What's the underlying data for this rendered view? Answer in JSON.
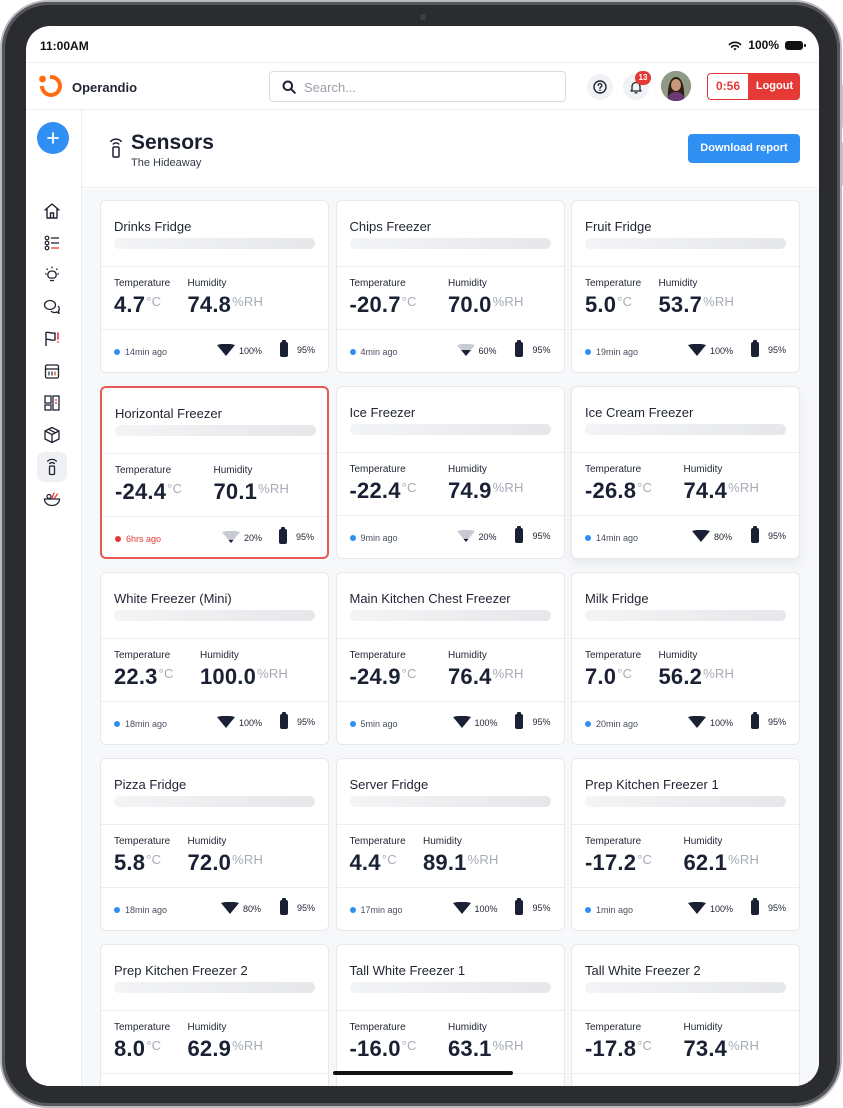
{
  "status_bar": {
    "time": "11:00AM",
    "battery": "100%"
  },
  "header": {
    "brand": "Operandio",
    "search_placeholder": "Search...",
    "notifications_count": "13",
    "timer": "0:56",
    "logout_label": "Logout"
  },
  "page": {
    "title": "Sensors",
    "subtitle": "The Hideaway",
    "download_label": "Download report"
  },
  "labels": {
    "temperature": "Temperature",
    "humidity": "Humidity",
    "temp_unit": "°C",
    "humidity_unit": "%RH"
  },
  "sidebar_icons": [
    "plus-icon",
    "home-icon",
    "checklist-icon",
    "lightbulb-icon",
    "chat-icon",
    "flag-icon",
    "calendar-icon",
    "dashboard-icon",
    "box-icon",
    "sensor-icon",
    "food-icon"
  ],
  "sensors": [
    {
      "name": "Drinks Fridge",
      "temperature": "4.7",
      "humidity": "74.8",
      "last_seen": "14min ago",
      "signal": "100%",
      "battery": "95%",
      "status": "ok"
    },
    {
      "name": "Chips Freezer",
      "temperature": "-20.7",
      "humidity": "70.0",
      "last_seen": "4min ago",
      "signal": "60%",
      "battery": "95%",
      "status": "ok"
    },
    {
      "name": "Fruit Fridge",
      "temperature": "5.0",
      "humidity": "53.7",
      "last_seen": "19min ago",
      "signal": "100%",
      "battery": "95%",
      "status": "ok"
    },
    {
      "name": "Horizontal Freezer",
      "temperature": "-24.4",
      "humidity": "70.1",
      "last_seen": "6hrs ago",
      "signal": "20%",
      "battery": "95%",
      "status": "alert"
    },
    {
      "name": "Ice Freezer",
      "temperature": "-22.4",
      "humidity": "74.9",
      "last_seen": "9min ago",
      "signal": "20%",
      "battery": "95%",
      "status": "ok"
    },
    {
      "name": "Ice Cream Freezer",
      "temperature": "-26.8",
      "humidity": "74.4",
      "last_seen": "14min ago",
      "signal": "80%",
      "battery": "95%",
      "status": "ok"
    },
    {
      "name": "White Freezer (Mini)",
      "temperature": "22.3",
      "humidity": "100.0",
      "last_seen": "18min ago",
      "signal": "100%",
      "battery": "95%",
      "status": "ok"
    },
    {
      "name": "Main Kitchen Chest Freezer",
      "temperature": "-24.9",
      "humidity": "76.4",
      "last_seen": "5min ago",
      "signal": "100%",
      "battery": "95%",
      "status": "ok"
    },
    {
      "name": "Milk Fridge",
      "temperature": "7.0",
      "humidity": "56.2",
      "last_seen": "20min ago",
      "signal": "100%",
      "battery": "95%",
      "status": "ok"
    },
    {
      "name": "Pizza Fridge",
      "temperature": "5.8",
      "humidity": "72.0",
      "last_seen": "18min ago",
      "signal": "80%",
      "battery": "95%",
      "status": "ok"
    },
    {
      "name": "Server Fridge",
      "temperature": "4.4",
      "humidity": "89.1",
      "last_seen": "17min ago",
      "signal": "100%",
      "battery": "95%",
      "status": "ok"
    },
    {
      "name": "Prep Kitchen Freezer 1",
      "temperature": "-17.2",
      "humidity": "62.1",
      "last_seen": "1min ago",
      "signal": "100%",
      "battery": "95%",
      "status": "ok"
    },
    {
      "name": "Prep Kitchen Freezer 2",
      "temperature": "8.0",
      "humidity": "62.9",
      "last_seen": "",
      "signal": "",
      "battery": "",
      "status": "ok"
    },
    {
      "name": "Tall White Freezer 1",
      "temperature": "-16.0",
      "humidity": "63.1",
      "last_seen": "",
      "signal": "",
      "battery": "",
      "status": "ok"
    },
    {
      "name": "Tall White Freezer 2",
      "temperature": "-17.8",
      "humidity": "73.4",
      "last_seen": "",
      "signal": "",
      "battery": "",
      "status": "ok"
    }
  ],
  "colors": {
    "accent": "#2f8ff2",
    "danger": "#e53935",
    "text": "#1b2134",
    "muted": "#a6abb6"
  }
}
